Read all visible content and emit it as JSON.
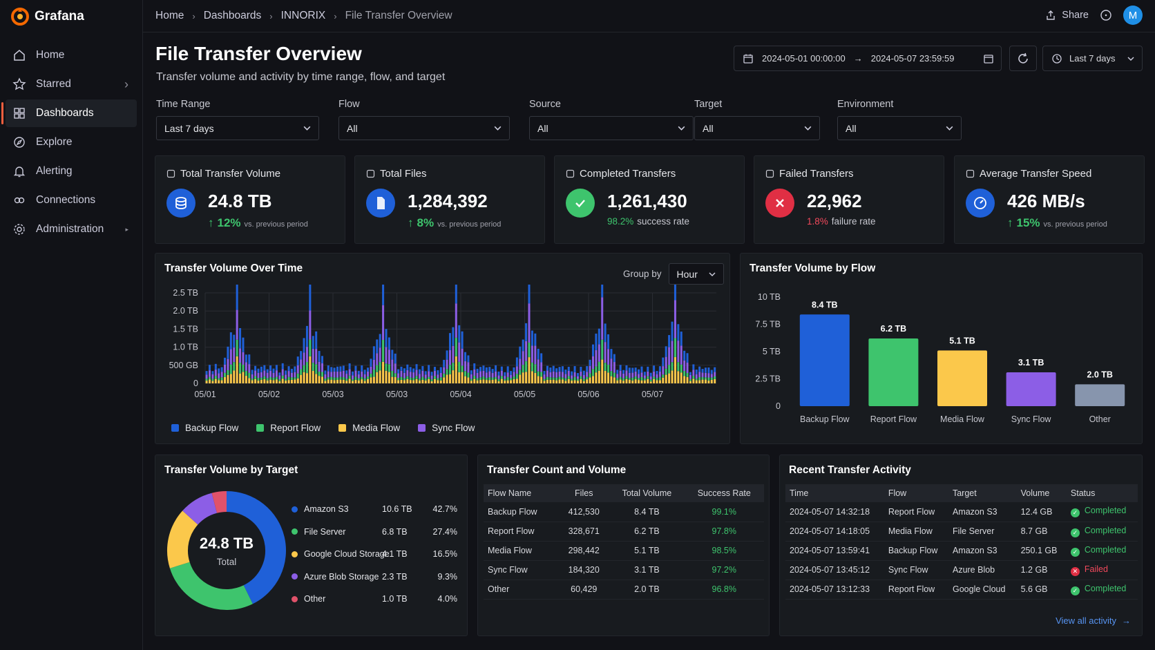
{
  "app": {
    "name": "Grafana"
  },
  "sidebar": {
    "items": [
      {
        "label": "Home",
        "icon": "home-icon"
      },
      {
        "label": "Starred",
        "icon": "star-icon"
      },
      {
        "label": "Dashboards",
        "icon": "dashboards-icon"
      },
      {
        "label": "Explore",
        "icon": "explore-icon"
      },
      {
        "label": "Alerting",
        "icon": "bell-icon"
      },
      {
        "label": "Connections",
        "icon": "connections-icon"
      },
      {
        "label": "Administration",
        "icon": "gear-icon"
      }
    ]
  },
  "breadcrumb": [
    "Home",
    "Dashboards",
    "INNORIX",
    "File Transfer Overview"
  ],
  "topbar": {
    "share_label": "Share",
    "avatar_initial": "M"
  },
  "header": {
    "title": "File Transfer Overview",
    "subtitle": "Transfer volume and activity by time range, flow, and target",
    "time_from": "2024-05-01 00:00:00",
    "time_to": "2024-05-07 23:59:59",
    "range_label": "Last 7 days"
  },
  "filters": [
    {
      "label": "Time Range",
      "value": "Last 7 days"
    },
    {
      "label": "Flow",
      "value": "All"
    },
    {
      "label": "Source",
      "value": "All"
    },
    {
      "label": "Target",
      "value": "All"
    },
    {
      "label": "Environment",
      "value": "All"
    }
  ],
  "stats": [
    {
      "title": "Total Transfer Volume",
      "value": "24.8 TB",
      "delta": "12%",
      "note": "vs. previous period",
      "color": "#1f60d8"
    },
    {
      "title": "Total Files",
      "value": "1,284,392",
      "delta": "8%",
      "note": "vs. previous period",
      "color": "#1f60d8"
    },
    {
      "title": "Completed Transfers",
      "value": "1,261,430",
      "rate": "98.2%",
      "rate_label": "success rate",
      "color": "#3ec46d"
    },
    {
      "title": "Failed Transfers",
      "value": "22,962",
      "rate": "1.8%",
      "rate_label": "failure rate",
      "color": "#e02f44"
    },
    {
      "title": "Average Transfer Speed",
      "value": "426 MB/s",
      "delta": "15%",
      "note": "vs. previous period",
      "color": "#1f60d8"
    }
  ],
  "volume_time": {
    "title": "Transfer Volume Over Time",
    "group_by_label": "Group by",
    "group_by_value": "Hour",
    "y_ticks": [
      "2.5 TB",
      "2.0 TB",
      "1.5 TB",
      "1.0 TB",
      "500 GB",
      "0"
    ],
    "x_ticks": [
      "05/01",
      "05/02",
      "05/03",
      "05/03",
      "05/04",
      "05/05",
      "05/06",
      "05/07"
    ],
    "legend": [
      {
        "name": "Backup Flow",
        "color": "#1f60d8"
      },
      {
        "name": "Report Flow",
        "color": "#3ec46d"
      },
      {
        "name": "Media Flow",
        "color": "#fbc84b"
      },
      {
        "name": "Sync Flow",
        "color": "#8c5ee6"
      }
    ]
  },
  "chart_data": [
    {
      "type": "bar",
      "title": "Transfer Volume by Flow",
      "categories": [
        "Backup Flow",
        "Report Flow",
        "Media Flow",
        "Sync Flow",
        "Other"
      ],
      "values": [
        8.4,
        6.2,
        5.1,
        3.1,
        2.0
      ],
      "labels": [
        "8.4 TB",
        "6.2 TB",
        "5.1 TB",
        "3.1 TB",
        "2.0 TB"
      ],
      "colors": [
        "#1f60d8",
        "#3ec46d",
        "#fbc84b",
        "#8c5ee6",
        "#8795ad"
      ],
      "y_ticks": [
        "10 TB",
        "7.5 TB",
        "5 TB",
        "2.5 TB",
        "0"
      ],
      "ylim": [
        0,
        10
      ]
    },
    {
      "type": "pie",
      "title": "Transfer Volume by Target",
      "center_value": "24.8 TB",
      "center_label": "Total",
      "slices": [
        {
          "name": "Amazon S3",
          "value": "10.6 TB",
          "pct": "42.7%",
          "share": 42.7,
          "color": "#1f60d8"
        },
        {
          "name": "File Server",
          "value": "6.8 TB",
          "pct": "27.4%",
          "share": 27.4,
          "color": "#3ec46d"
        },
        {
          "name": "Google Cloud Storage",
          "value": "4.1 TB",
          "pct": "16.5%",
          "share": 16.5,
          "color": "#fbc84b"
        },
        {
          "name": "Azure Blob Storage",
          "value": "2.3 TB",
          "pct": "9.3%",
          "share": 9.3,
          "color": "#8c5ee6"
        },
        {
          "name": "Other",
          "value": "1.0 TB",
          "pct": "4.0%",
          "share": 4.0,
          "color": "#e0526a"
        }
      ]
    }
  ],
  "flow_table": {
    "title": "Transfer Count and Volume",
    "headers": [
      "Flow Name",
      "Files",
      "Total Volume",
      "Success Rate"
    ],
    "rows": [
      [
        "Backup Flow",
        "412,530",
        "8.4 TB",
        "99.1%"
      ],
      [
        "Report Flow",
        "328,671",
        "6.2 TB",
        "97.8%"
      ],
      [
        "Media Flow",
        "298,442",
        "5.1 TB",
        "98.5%"
      ],
      [
        "Sync Flow",
        "184,320",
        "3.1 TB",
        "97.2%"
      ],
      [
        "Other",
        "60,429",
        "2.0 TB",
        "96.8%"
      ]
    ]
  },
  "activity": {
    "title": "Recent Transfer Activity",
    "headers": [
      "Time",
      "Flow",
      "Target",
      "Volume",
      "Status"
    ],
    "rows": [
      [
        "2024-05-07 14:32:18",
        "Report Flow",
        "Amazon S3",
        "12.4 GB",
        "Completed"
      ],
      [
        "2024-05-07 14:18:05",
        "Media Flow",
        "File Server",
        "8.7 GB",
        "Completed"
      ],
      [
        "2024-05-07 13:59:41",
        "Backup Flow",
        "Amazon S3",
        "250.1 GB",
        "Completed"
      ],
      [
        "2024-05-07 13:45:12",
        "Sync Flow",
        "Azure Blob",
        "1.2 GB",
        "Failed"
      ],
      [
        "2024-05-07 13:12:33",
        "Report Flow",
        "Google Cloud",
        "5.6 GB",
        "Completed"
      ]
    ],
    "view_all": "View all activity"
  }
}
